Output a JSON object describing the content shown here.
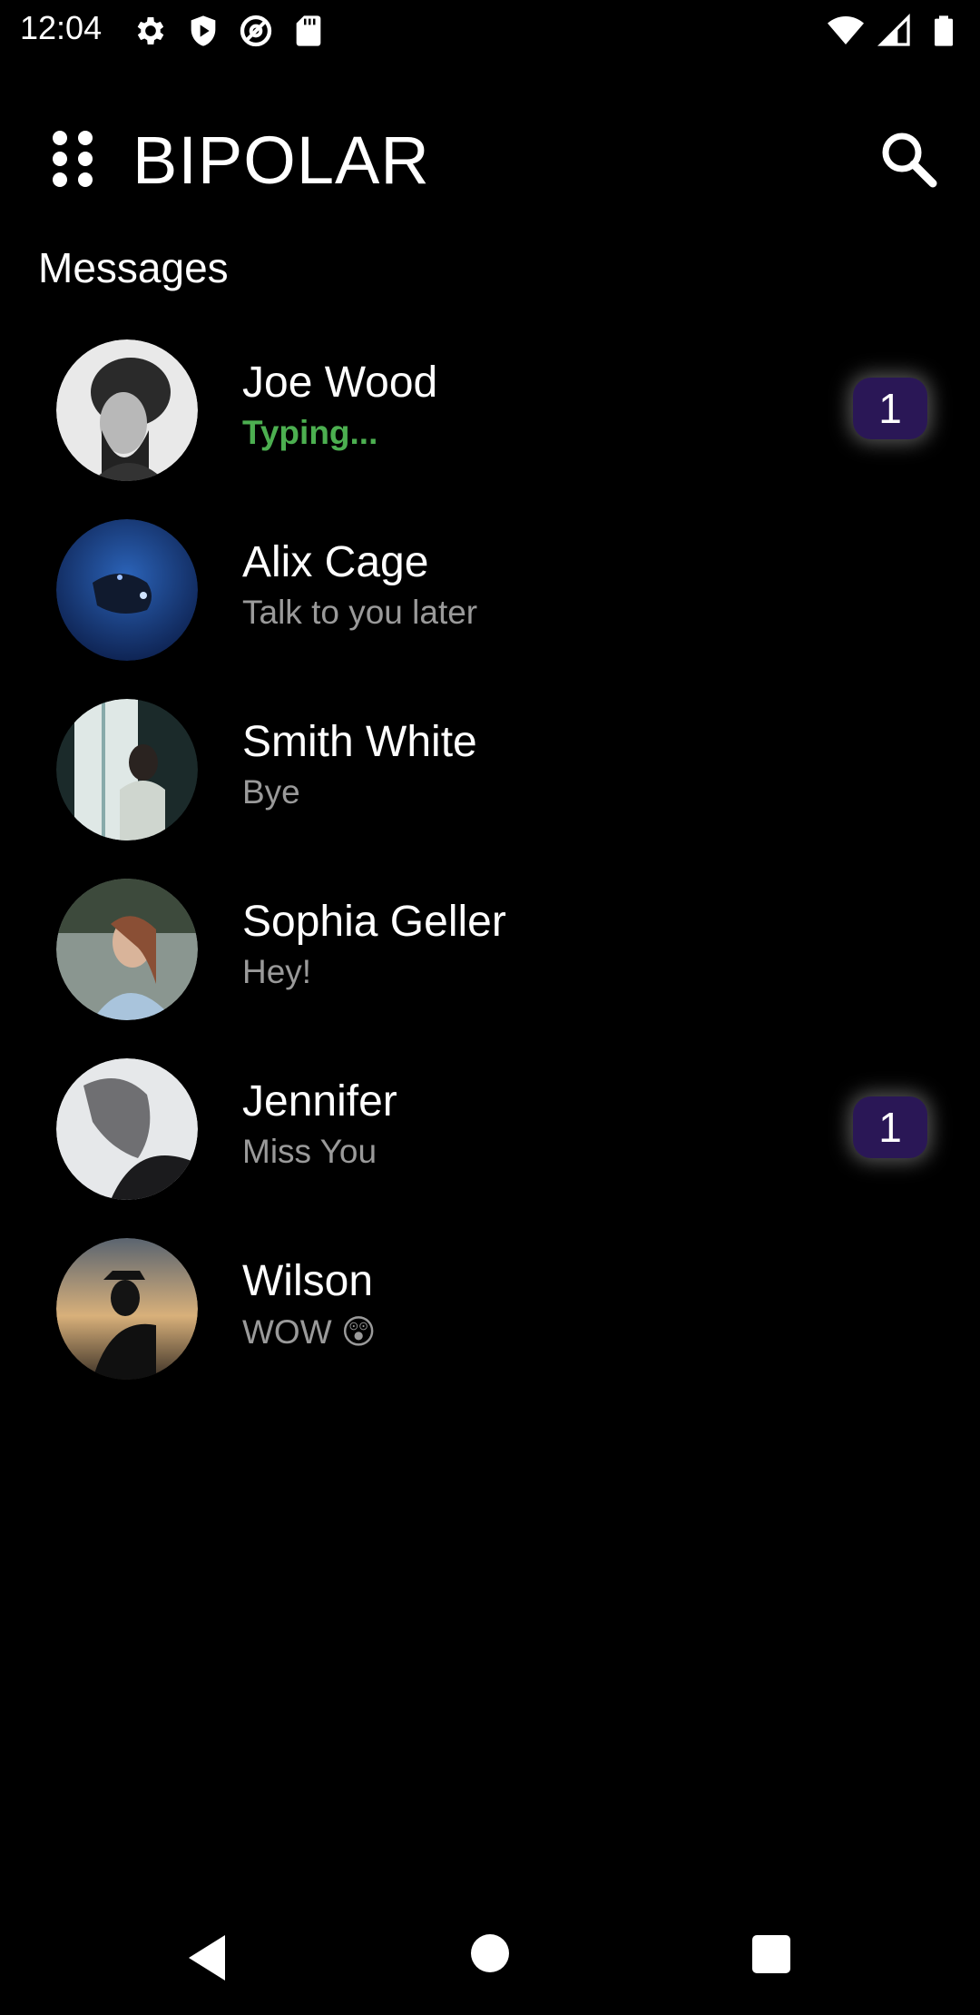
{
  "status_bar": {
    "time": "12:04",
    "left_icons": [
      "settings-icon",
      "shield-icon",
      "at-sign-icon",
      "sd-card-icon"
    ],
    "right_icons": [
      "wifi-icon",
      "signal-icon",
      "battery-icon"
    ]
  },
  "app_bar": {
    "title": "BIPOLAR",
    "menu_icon": "grid-dots-icon",
    "search_icon": "search-icon"
  },
  "section_title": "Messages",
  "conversations": [
    {
      "name": "Joe Wood",
      "message": "Typing...",
      "typing": true,
      "unread": "1"
    },
    {
      "name": "Alix Cage",
      "message": "Talk to you later",
      "typing": false,
      "unread": null
    },
    {
      "name": "Smith White",
      "message": "Bye",
      "typing": false,
      "unread": null
    },
    {
      "name": "Sophia Geller",
      "message": "Hey!",
      "typing": false,
      "unread": null
    },
    {
      "name": "Jennifer",
      "message": "Miss You",
      "typing": false,
      "unread": "1"
    },
    {
      "name": "Wilson",
      "message": "WOW 😲",
      "typing": false,
      "unread": null
    }
  ],
  "nav_bar": {
    "icons": [
      "back-icon",
      "home-icon",
      "recents-icon"
    ]
  },
  "colors": {
    "background": "#000000",
    "typing": "#4caf50",
    "badge": "#2a1756",
    "secondary_text": "#9a9a9a"
  }
}
